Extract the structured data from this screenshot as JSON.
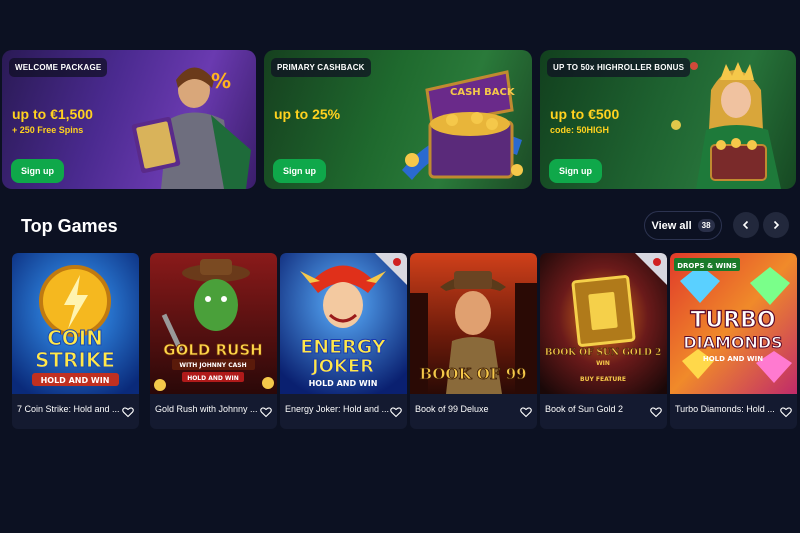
{
  "promos": [
    {
      "badge": "WELCOME PACKAGE",
      "offer": "up to €1,500",
      "sub": "+ 250 Free Spins",
      "button": "Sign up"
    },
    {
      "badge": "PRIMARY CASHBACK",
      "offer": "up to 25%",
      "sub": "",
      "button": "Sign up",
      "art_text": "CASH BACK"
    },
    {
      "badge": "UP TO 50x HIGHROLLER BONUS",
      "offer": "up to €500",
      "sub": "code: 50HIGH",
      "button": "Sign up"
    }
  ],
  "section": {
    "title": "Top Games",
    "view_all": "View all",
    "count": "38"
  },
  "games": [
    {
      "name": "7 Coin Strike: Hold and ...",
      "art_lines": [
        "COIN",
        "STRIKE",
        "HOLD AND WIN"
      ]
    },
    {
      "name": "Gold Rush with Johnny ...",
      "art_lines": [
        "GOLD RUSH",
        "WITH JOHNNY CASH",
        "HOLD AND WIN"
      ]
    },
    {
      "name": "Energy Joker: Hold and ...",
      "art_lines": [
        "ENERGY",
        "JOKER",
        "HOLD AND WIN"
      ]
    },
    {
      "name": "Book of 99 Deluxe",
      "art_lines": [
        "BOOK OF 99"
      ]
    },
    {
      "name": "Book of Sun Gold 2",
      "art_lines": [
        "BOOK OF SUN GOLD 2",
        "WIN",
        "BUY FEATURE"
      ]
    },
    {
      "name": "Turbo Diamonds: Hold ...",
      "art_lines": [
        "TURBO",
        "DIAMONDS",
        "HOLD AND WIN",
        "DROPS & WINS"
      ]
    }
  ],
  "colors": {
    "background": "#0c1122",
    "accent_green": "#0fa84a",
    "offer_yellow": "#ffd21f"
  }
}
